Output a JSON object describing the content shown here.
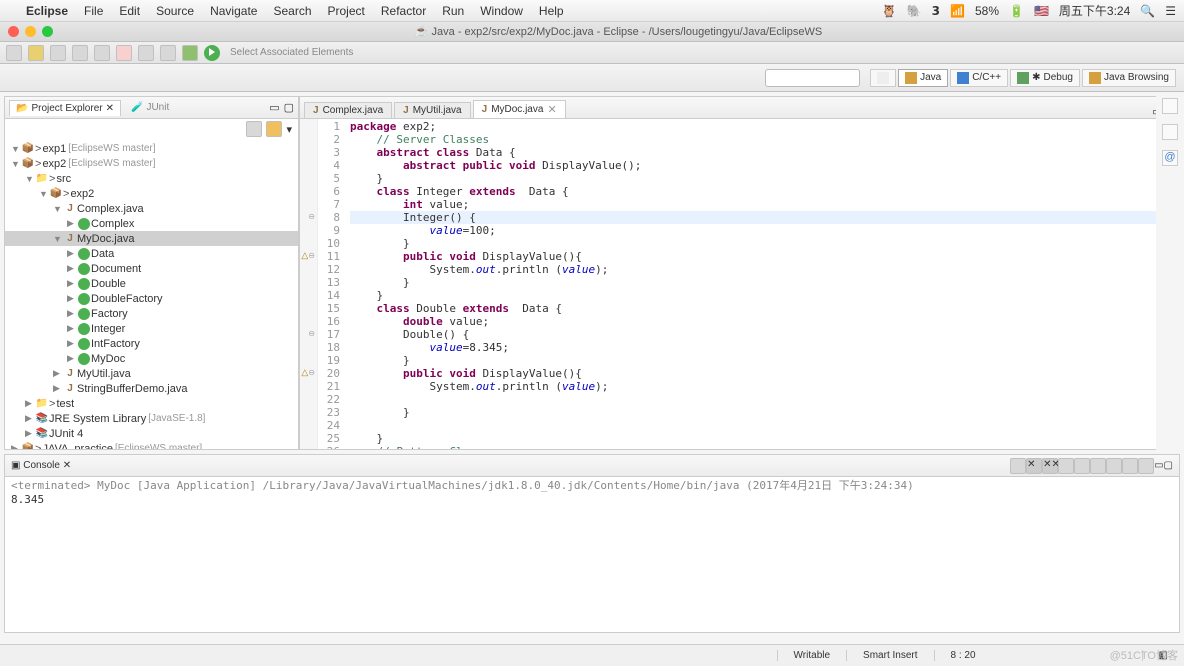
{
  "mac_menu": {
    "apple": "",
    "app": "Eclipse",
    "items": [
      "File",
      "Edit",
      "Source",
      "Navigate",
      "Search",
      "Project",
      "Refactor",
      "Run",
      "Window",
      "Help"
    ]
  },
  "mac_right": {
    "battery": "58%",
    "flag": "🇺🇸",
    "clock": "周五下午3:24"
  },
  "window_title": "Java - exp2/src/exp2/MyDoc.java - Eclipse - /Users/lougetingyu/Java/EclipseWS",
  "toolbar": {
    "select": "Select Associated Elements"
  },
  "perspectives": [
    "Java",
    "C/C++",
    "Debug",
    "Java Browsing"
  ],
  "project_explorer": {
    "title": "Project Explorer",
    "junit": "JUnit"
  },
  "tree": [
    {
      "d": 0,
      "t": "▼",
      "i": "📦",
      "l": "exp1",
      "deco": "[EclipseWS master]",
      "git": true
    },
    {
      "d": 0,
      "t": "▼",
      "i": "📦",
      "l": "exp2",
      "deco": "[EclipseWS master]",
      "git": true
    },
    {
      "d": 1,
      "t": "▼",
      "i": "📁",
      "l": "src",
      "git": true
    },
    {
      "d": 2,
      "t": "▼",
      "i": "📦",
      "l": "exp2",
      "git": true
    },
    {
      "d": 3,
      "t": "▼",
      "i": "J",
      "l": "Complex.java"
    },
    {
      "d": 4,
      "t": "▶",
      "i": "C",
      "l": "Complex"
    },
    {
      "d": 3,
      "t": "▼",
      "i": "J",
      "l": "MyDoc.java",
      "sel": true
    },
    {
      "d": 4,
      "t": "▶",
      "i": "C",
      "l": "Data"
    },
    {
      "d": 4,
      "t": "▶",
      "i": "C",
      "l": "Document"
    },
    {
      "d": 4,
      "t": "▶",
      "i": "C",
      "l": "Double"
    },
    {
      "d": 4,
      "t": "▶",
      "i": "C",
      "l": "DoubleFactory"
    },
    {
      "d": 4,
      "t": "▶",
      "i": "C",
      "l": "Factory"
    },
    {
      "d": 4,
      "t": "▶",
      "i": "C",
      "l": "Integer"
    },
    {
      "d": 4,
      "t": "▶",
      "i": "C",
      "l": "IntFactory"
    },
    {
      "d": 4,
      "t": "▶",
      "i": "C",
      "l": "MyDoc"
    },
    {
      "d": 3,
      "t": "▶",
      "i": "J",
      "l": "MyUtil.java"
    },
    {
      "d": 3,
      "t": "▶",
      "i": "J",
      "l": "StringBufferDemo.java"
    },
    {
      "d": 1,
      "t": "▶",
      "i": "📁",
      "l": "test",
      "git": true
    },
    {
      "d": 1,
      "t": "▶",
      "i": "L",
      "l": "JRE System Library",
      "deco": "[JavaSE-1.8]"
    },
    {
      "d": 1,
      "t": "▶",
      "i": "L",
      "l": "JUnit 4"
    },
    {
      "d": 0,
      "t": "▶",
      "i": "📦",
      "l": "JAVA_practice",
      "deco": "[EclipseWS master]",
      "git": true
    }
  ],
  "editor_tabs": [
    {
      "l": "Complex.java",
      "a": false
    },
    {
      "l": "MyUtil.java",
      "a": false
    },
    {
      "l": "MyDoc.java",
      "a": true
    }
  ],
  "code_lines": [
    {
      "n": 1,
      "h": "<span class='kw'>package</span> exp2;"
    },
    {
      "n": 2,
      "h": "    <span class='cm'>// Server Classes</span>"
    },
    {
      "n": 3,
      "h": "    <span class='kw'>abstract</span> <span class='kw'>class</span> Data {"
    },
    {
      "n": 4,
      "h": "        <span class='kw'>abstract</span> <span class='kw'>public</span> <span class='kw'>void</span> DisplayValue();"
    },
    {
      "n": 5,
      "h": "    }"
    },
    {
      "n": 6,
      "h": "    <span class='kw'>class</span> Integer <span class='kw'>extends</span>  Data {"
    },
    {
      "n": 7,
      "h": "        <span class='kw'>int</span> value;"
    },
    {
      "n": 8,
      "h": "        Integer() {",
      "f": "⊖",
      "hl": true
    },
    {
      "n": 9,
      "h": "            <span class='fi'>value</span>=100;"
    },
    {
      "n": 10,
      "h": "        }"
    },
    {
      "n": 11,
      "h": "        <span class='kw'>public</span> <span class='kw'>void</span> DisplayValue(){",
      "f": "⊖",
      "ann": "△"
    },
    {
      "n": 12,
      "h": "            System.<span class='fi'>out</span>.println (<span class='fi'>value</span>);"
    },
    {
      "n": 13,
      "h": "        }"
    },
    {
      "n": 14,
      "h": "    }"
    },
    {
      "n": 15,
      "h": "    <span class='kw'>class</span> Double <span class='kw'>extends</span>  Data {"
    },
    {
      "n": 16,
      "h": "        <span class='kw'>double</span> value;"
    },
    {
      "n": 17,
      "h": "        Double() {",
      "f": "⊖"
    },
    {
      "n": 18,
      "h": "            <span class='fi'>value</span>=8.345;"
    },
    {
      "n": 19,
      "h": "        }"
    },
    {
      "n": 20,
      "h": "        <span class='kw'>public</span> <span class='kw'>void</span> DisplayValue(){",
      "f": "⊖",
      "ann": "△"
    },
    {
      "n": 21,
      "h": "            System.<span class='fi'>out</span>.println (<span class='fi'>value</span>);"
    },
    {
      "n": 22,
      "h": ""
    },
    {
      "n": 23,
      "h": "        }"
    },
    {
      "n": 24,
      "h": ""
    },
    {
      "n": 25,
      "h": "    }"
    },
    {
      "n": 26,
      "h": "    <span class='cm'>// Pattern Classes</span>"
    }
  ],
  "console": {
    "title": "Console",
    "header": "<terminated> MyDoc [Java Application] /Library/Java/JavaVirtualMachines/jdk1.8.0_40.jdk/Contents/Home/bin/java (2017年4月21日 下午3:24:34)",
    "output": "8.345"
  },
  "status": {
    "writable": "Writable",
    "insert": "Smart Insert",
    "pos": "8 : 20"
  },
  "watermark": "@51CTO博客"
}
